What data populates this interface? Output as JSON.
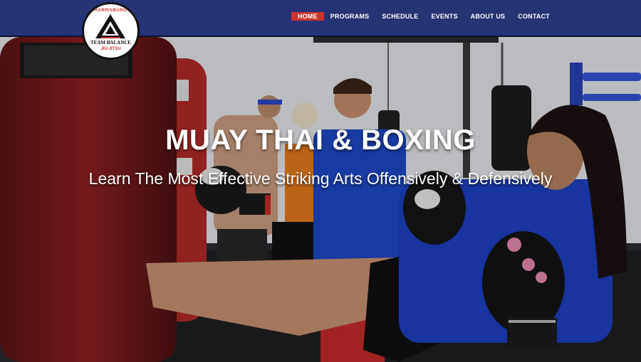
{
  "logo": {
    "top_text": "HARRISBURG",
    "name": "TEAM BALANCE",
    "sub_text": "JIU-JITSU"
  },
  "nav": {
    "items": [
      {
        "label": "HOME",
        "active": true
      },
      {
        "label": "PROGRAMS",
        "active": false
      },
      {
        "label": "SCHEDULE",
        "active": false
      },
      {
        "label": "EVENTS",
        "active": false
      },
      {
        "label": "ABOUT US",
        "active": false
      },
      {
        "label": "CONTACT",
        "active": false
      }
    ]
  },
  "hero": {
    "title": "MUAY THAI & BOXING",
    "subtitle": "Learn The Most Effective Striking Arts Offensively & Defensively"
  },
  "colors": {
    "header_bg": "#263374",
    "nav_active_bg": "#c9332b",
    "text": "#ffffff"
  }
}
